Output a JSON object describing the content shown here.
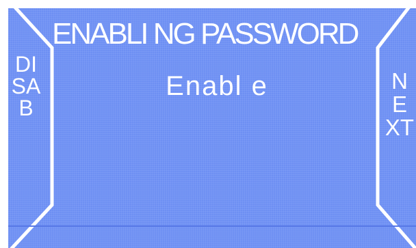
{
  "screen": {
    "title": "ENABLI NG PASSWORD",
    "value": "Enabl e",
    "left_softkey_label": "DISAB",
    "right_softkey_label": "NEXT"
  },
  "colors": {
    "background": "#6d8ff3",
    "frame": "#ffffff",
    "text": "#ffffff"
  }
}
